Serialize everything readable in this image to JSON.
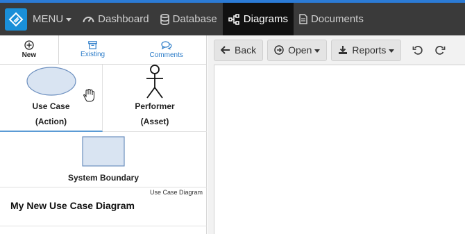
{
  "navbar": {
    "menu_label": "MENU",
    "items": [
      {
        "label": "Dashboard",
        "icon": "dashboard-icon"
      },
      {
        "label": "Database",
        "icon": "database-icon"
      },
      {
        "label": "Diagrams",
        "icon": "diagrams-icon",
        "active": true
      },
      {
        "label": "Documents",
        "icon": "document-icon"
      }
    ],
    "accent": "#2b7bd6"
  },
  "left_tabs": [
    {
      "label": "New",
      "icon": "plus-circle-icon"
    },
    {
      "label": "Existing",
      "icon": "archive-icon"
    },
    {
      "label": "Comments",
      "icon": "comments-icon"
    }
  ],
  "shapes": {
    "use_case": {
      "line1": "Use Case",
      "line2": "(Action)"
    },
    "performer": {
      "line1": "Performer",
      "line2": "(Asset)"
    },
    "boundary": {
      "label": "System Boundary"
    }
  },
  "diagram": {
    "type": "Use Case Diagram",
    "name": "My New Use Case Diagram"
  },
  "toolbar": {
    "back_label": "Back",
    "open_label": "Open",
    "reports_label": "Reports"
  }
}
